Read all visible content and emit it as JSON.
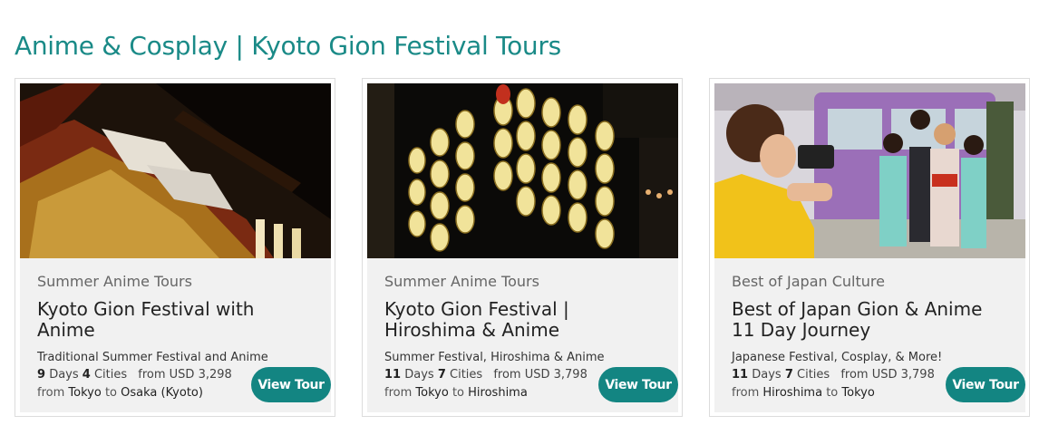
{
  "page": {
    "title": "Anime & Cosplay | Kyoto Gion Festival Tours"
  },
  "colors": {
    "accent": "#138582",
    "title": "#1a8a87",
    "card_body_bg": "#f1f1f1"
  },
  "cards": [
    {
      "category": "Summer Anime Tours",
      "title": "Kyoto Gion Festival with Anime",
      "description": "Traditional Summer Festival and Anime",
      "days": "9",
      "days_label": "Days",
      "cities": "4",
      "cities_label": "Cities",
      "price": "from USD 3,298",
      "from_label": "from",
      "from_city": "Tokyo",
      "to_label": "to",
      "to_city": "Osaka (Kyoto)",
      "button": "View Tour",
      "image": "gion-festival-float-photo"
    },
    {
      "category": "Summer Anime Tours",
      "title": "Kyoto Gion Festival | Hiroshima & Anime",
      "description": "Summer Festival, Hiroshima & Anime",
      "days": "11",
      "days_label": "Days",
      "cities": "7",
      "cities_label": "Cities",
      "price": "from USD 3,798",
      "from_label": "from",
      "from_city": "Tokyo",
      "to_label": "to",
      "to_city": "Hiroshima",
      "button": "View Tour",
      "image": "paper-lanterns-night-photo"
    },
    {
      "category": "Best of Japan Culture",
      "title": "Best of Japan Gion & Anime 11 Day Journey",
      "description": "Japanese Festival, Cosplay, & More!",
      "days": "11",
      "days_label": "Days",
      "cities": "7",
      "cities_label": "Cities",
      "price": "from USD 3,798",
      "from_label": "from",
      "from_city": "Hiroshima",
      "to_label": "to",
      "to_city": "Tokyo",
      "button": "View Tour",
      "image": "kimono-photographer-train-photo"
    }
  ]
}
